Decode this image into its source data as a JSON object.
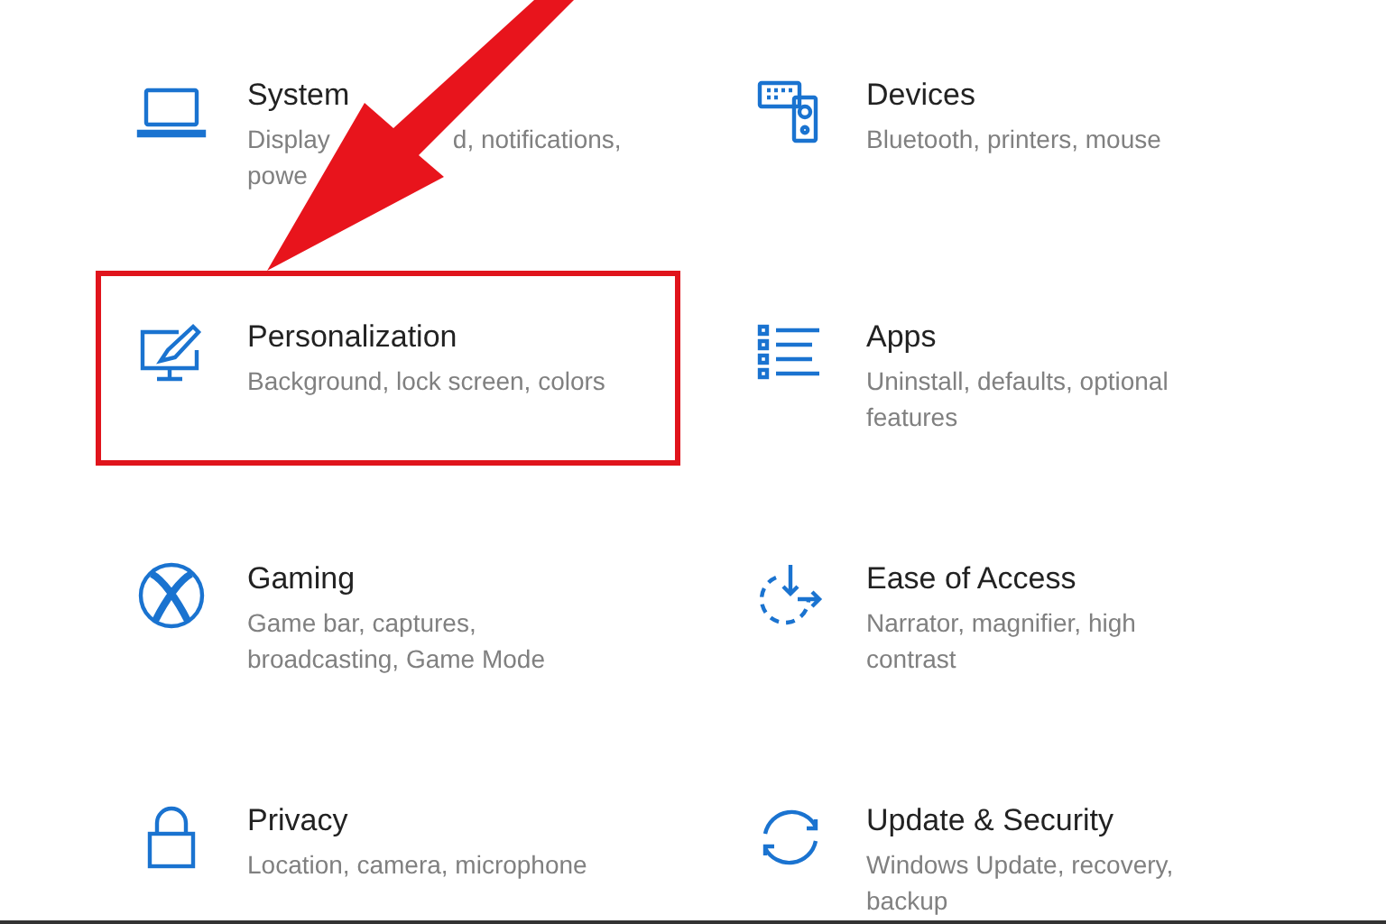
{
  "settings": [
    {
      "title": "System",
      "description_lines": [
        [
          "Display",
          "d, notifications,"
        ],
        [
          "powe"
        ]
      ],
      "highlighted": false
    },
    {
      "title": "Devices",
      "description_lines": [
        [
          "Bluetooth, printers, mouse"
        ]
      ],
      "highlighted": false
    },
    {
      "title": "Personalization",
      "description_lines": [
        [
          "Background, lock screen, colors"
        ]
      ],
      "highlighted": true
    },
    {
      "title": "Apps",
      "description_lines": [
        [
          "Uninstall, defaults, optional"
        ],
        [
          "features"
        ]
      ],
      "highlighted": false
    },
    {
      "title": "Gaming",
      "description_lines": [
        [
          "Game bar, captures,"
        ],
        [
          "broadcasting, Game Mode"
        ]
      ],
      "highlighted": false
    },
    {
      "title": "Ease of Access",
      "description_lines": [
        [
          "Narrator, magnifier, high"
        ],
        [
          "contrast"
        ]
      ],
      "highlighted": false
    },
    {
      "title": "Privacy",
      "description_lines": [
        [
          "Location, camera, microphone"
        ]
      ],
      "highlighted": false
    },
    {
      "title": "Update & Security",
      "description_lines": [
        [
          "Windows Update, recovery,"
        ],
        [
          "backup"
        ]
      ],
      "highlighted": false
    }
  ]
}
